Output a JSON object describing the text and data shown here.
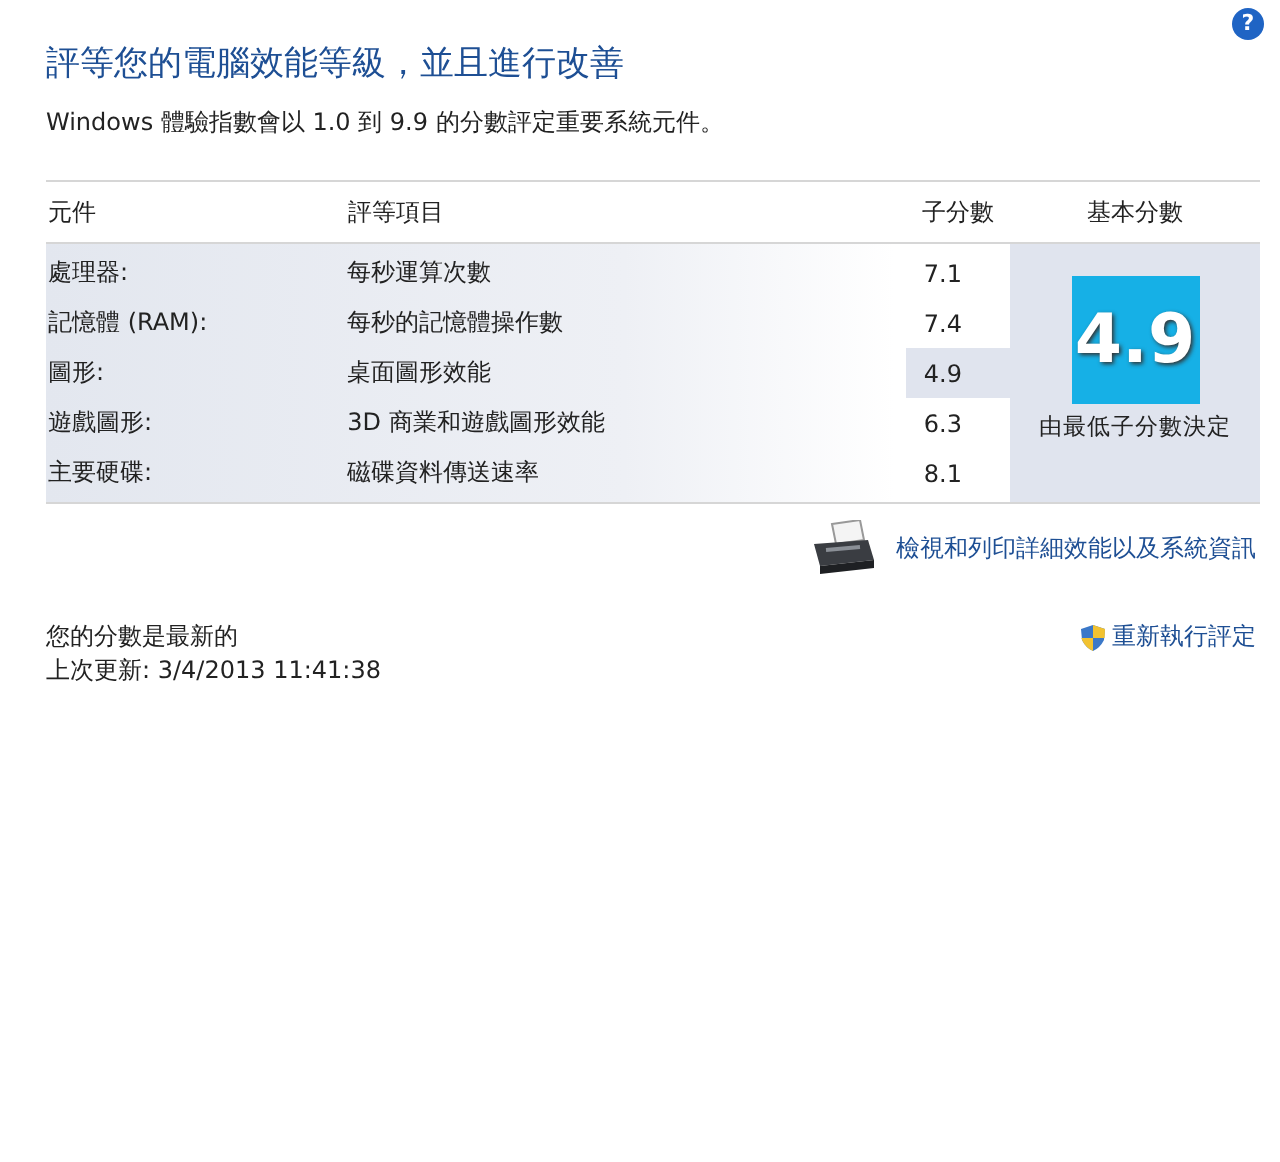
{
  "help_button": "?",
  "title": "評等您的電腦效能等級，並且進行改善",
  "description": "Windows 體驗指數會以 1.0 到 9.9 的分數評定重要系統元件。",
  "table": {
    "columns": [
      "元件",
      "評等項目",
      "子分數",
      "基本分數"
    ],
    "rows": [
      {
        "component": "處理器:",
        "rating_item": "每秒運算次數",
        "subscore": "7.1",
        "lowest": false
      },
      {
        "component": "記憶體 (RAM):",
        "rating_item": "每秒的記憶體操作數",
        "subscore": "7.4",
        "lowest": false
      },
      {
        "component": "圖形:",
        "rating_item": "桌面圖形效能",
        "subscore": "4.9",
        "lowest": true
      },
      {
        "component": "遊戲圖形:",
        "rating_item": "3D 商業和遊戲圖形效能",
        "subscore": "6.3",
        "lowest": false
      },
      {
        "component": "主要硬碟:",
        "rating_item": "磁碟資料傳送速率",
        "subscore": "8.1",
        "lowest": false
      }
    ],
    "base_score": "4.9",
    "base_score_note": "由最低子分數決定"
  },
  "print_link": "檢視和列印詳細效能以及系統資訊",
  "status": "您的分數是最新的",
  "last_update": "上次更新: 3/4/2013 11:41:38",
  "rerun_link": "重新執行評定"
}
